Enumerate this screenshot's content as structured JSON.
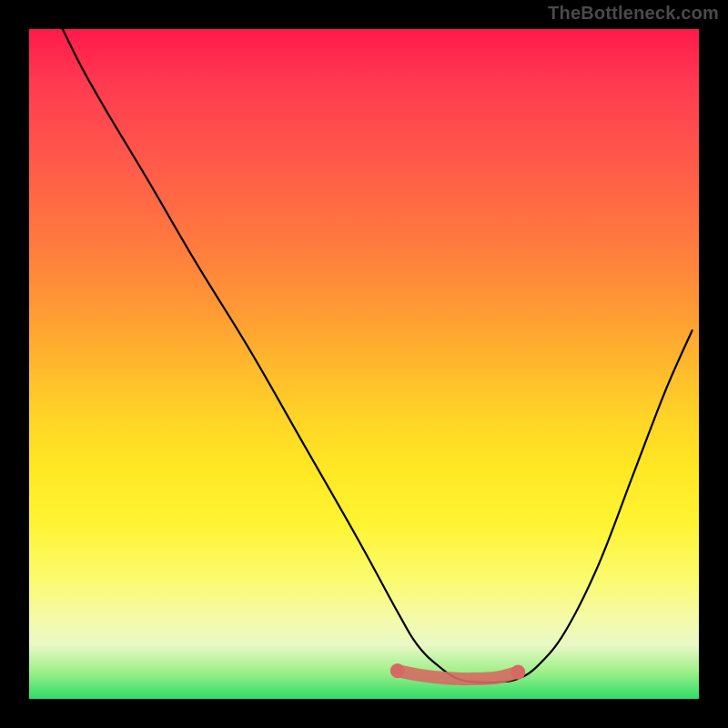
{
  "watermark": "TheBottleneck.com",
  "chart_data": {
    "type": "line",
    "title": "",
    "xlabel": "",
    "ylabel": "",
    "xlim": [
      0,
      100
    ],
    "ylim": [
      0,
      100
    ],
    "series": [
      {
        "name": "curve",
        "x": [
          5,
          8,
          12,
          18,
          25,
          33,
          41,
          49,
          55,
          58,
          61,
          64,
          67,
          70,
          73,
          76,
          80,
          85,
          90,
          95,
          99
        ],
        "y": [
          100,
          94,
          87,
          77,
          65,
          52,
          38,
          24,
          13,
          8,
          5,
          3,
          2.5,
          2.5,
          3,
          5,
          10,
          20,
          33,
          46,
          55
        ]
      }
    ],
    "marker_band": {
      "name": "optimal-range",
      "color": "#d66a63",
      "x": [
        55,
        58,
        61,
        64,
        67,
        70,
        73
      ],
      "y": [
        4.2,
        3.6,
        3.2,
        3.0,
        3.0,
        3.2,
        4.0
      ]
    },
    "gradient_stops": [
      {
        "pos": 0.0,
        "color": "#ff1a4b"
      },
      {
        "pos": 0.5,
        "color": "#ffd427"
      },
      {
        "pos": 0.92,
        "color": "#e8f9c5"
      },
      {
        "pos": 1.0,
        "color": "#2fdc6a"
      }
    ]
  }
}
